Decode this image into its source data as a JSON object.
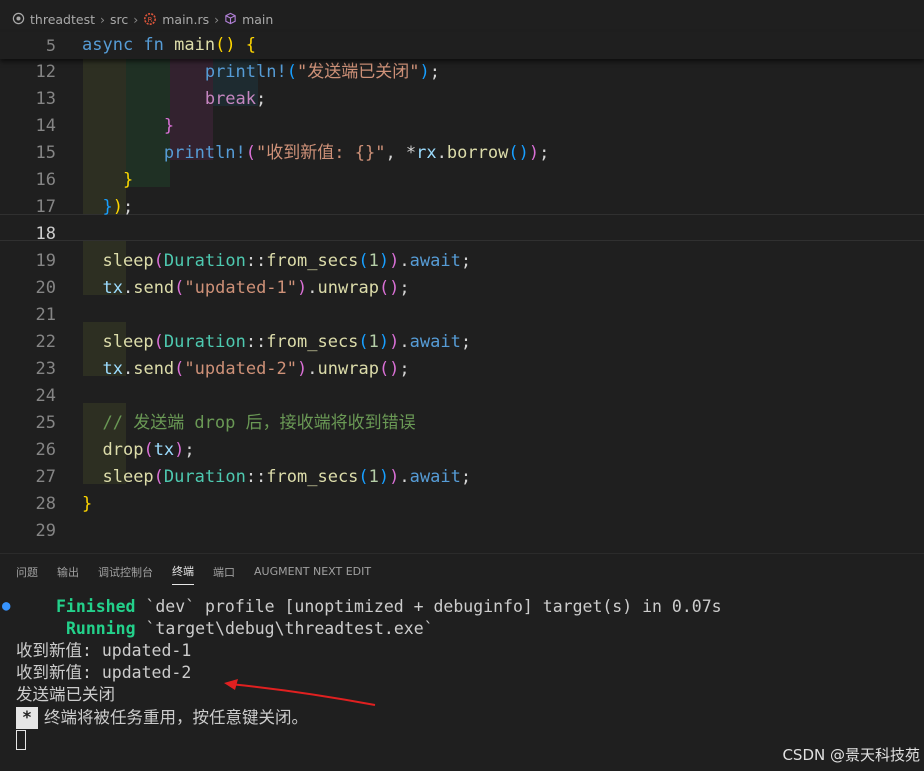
{
  "breadcrumb": {
    "project": "threadtest",
    "folder": "src",
    "file": "main.rs",
    "symbol": "main",
    "project_icon": "target-icon",
    "file_icon": "rust-icon",
    "symbol_icon": "cube-icon"
  },
  "editor": {
    "sticky": {
      "num": "5",
      "parts": [
        [
          "kw",
          "async "
        ],
        [
          "kw",
          "fn "
        ],
        [
          "fn",
          "main"
        ],
        [
          "b1",
          "() {"
        ]
      ]
    },
    "lines": [
      {
        "num": "12",
        "indent": 0,
        "parts": [
          [
            "",
            "            "
          ],
          [
            "mac",
            "println!"
          ],
          [
            "b3",
            "("
          ],
          [
            "str",
            "\"发送端已关闭\""
          ],
          [
            "b3",
            ")"
          ],
          [
            "op",
            ";"
          ]
        ]
      },
      {
        "num": "13",
        "parts": [
          [
            "",
            "            "
          ],
          [
            "ctl",
            "break"
          ],
          [
            "op",
            ";"
          ]
        ]
      },
      {
        "num": "14",
        "parts": [
          [
            "",
            "        "
          ],
          [
            "b2",
            "}"
          ]
        ]
      },
      {
        "num": "15",
        "parts": [
          [
            "",
            "        "
          ],
          [
            "mac",
            "println!"
          ],
          [
            "b2",
            "("
          ],
          [
            "str",
            "\"收到新值: {}\""
          ],
          [
            "op",
            ", *"
          ],
          [
            "var",
            "rx"
          ],
          [
            "op",
            "."
          ],
          [
            "fn",
            "borrow"
          ],
          [
            "b3",
            "()"
          ],
          [
            "b2",
            ")"
          ],
          [
            "op",
            ";"
          ]
        ]
      },
      {
        "num": "16",
        "parts": [
          [
            "",
            "    "
          ],
          [
            "b1",
            "}"
          ]
        ]
      },
      {
        "num": "17",
        "parts": [
          [
            "",
            "  "
          ],
          [
            "b3",
            "}"
          ],
          [
            "b1",
            ")"
          ],
          [
            "op",
            ";"
          ]
        ]
      },
      {
        "num": "18",
        "parts": [
          [
            "",
            ""
          ]
        ]
      },
      {
        "num": "19",
        "parts": [
          [
            "",
            "  "
          ],
          [
            "fn",
            "sleep"
          ],
          [
            "b2",
            "("
          ],
          [
            "ty",
            "Duration"
          ],
          [
            "op",
            "::"
          ],
          [
            "fn",
            "from_secs"
          ],
          [
            "b3",
            "("
          ],
          [
            "num",
            "1"
          ],
          [
            "b3",
            ")"
          ],
          [
            "b2",
            ")"
          ],
          [
            "op",
            "."
          ],
          [
            "kw",
            "await"
          ],
          [
            "op",
            ";"
          ]
        ]
      },
      {
        "num": "20",
        "parts": [
          [
            "",
            "  "
          ],
          [
            "var",
            "tx"
          ],
          [
            "op",
            "."
          ],
          [
            "fn",
            "send"
          ],
          [
            "b2",
            "("
          ],
          [
            "str",
            "\"updated-1\""
          ],
          [
            "b2",
            ")"
          ],
          [
            "op",
            "."
          ],
          [
            "fn",
            "unwrap"
          ],
          [
            "b2",
            "()"
          ],
          [
            "op",
            ";"
          ]
        ]
      },
      {
        "num": "21",
        "parts": [
          [
            "",
            ""
          ]
        ]
      },
      {
        "num": "22",
        "parts": [
          [
            "",
            "  "
          ],
          [
            "fn",
            "sleep"
          ],
          [
            "b2",
            "("
          ],
          [
            "ty",
            "Duration"
          ],
          [
            "op",
            "::"
          ],
          [
            "fn",
            "from_secs"
          ],
          [
            "b3",
            "("
          ],
          [
            "num",
            "1"
          ],
          [
            "b3",
            ")"
          ],
          [
            "b2",
            ")"
          ],
          [
            "op",
            "."
          ],
          [
            "kw",
            "await"
          ],
          [
            "op",
            ";"
          ]
        ]
      },
      {
        "num": "23",
        "parts": [
          [
            "",
            "  "
          ],
          [
            "var",
            "tx"
          ],
          [
            "op",
            "."
          ],
          [
            "fn",
            "send"
          ],
          [
            "b2",
            "("
          ],
          [
            "str",
            "\"updated-2\""
          ],
          [
            "b2",
            ")"
          ],
          [
            "op",
            "."
          ],
          [
            "fn",
            "unwrap"
          ],
          [
            "b2",
            "()"
          ],
          [
            "op",
            ";"
          ]
        ]
      },
      {
        "num": "24",
        "parts": [
          [
            "",
            ""
          ]
        ]
      },
      {
        "num": "25",
        "parts": [
          [
            "",
            "  "
          ],
          [
            "cm",
            "// 发送端 drop 后，接收端将收到错误"
          ]
        ]
      },
      {
        "num": "26",
        "parts": [
          [
            "",
            "  "
          ],
          [
            "fn",
            "drop"
          ],
          [
            "b2",
            "("
          ],
          [
            "var",
            "tx"
          ],
          [
            "b2",
            ")"
          ],
          [
            "op",
            ";"
          ]
        ]
      },
      {
        "num": "27",
        "parts": [
          [
            "",
            "  "
          ],
          [
            "fn",
            "sleep"
          ],
          [
            "b2",
            "("
          ],
          [
            "ty",
            "Duration"
          ],
          [
            "op",
            "::"
          ],
          [
            "fn",
            "from_secs"
          ],
          [
            "b3",
            "("
          ],
          [
            "num",
            "1"
          ],
          [
            "b3",
            ")"
          ],
          [
            "b2",
            ")"
          ],
          [
            "op",
            "."
          ],
          [
            "kw",
            "await"
          ],
          [
            "op",
            ";"
          ]
        ]
      },
      {
        "num": "28",
        "parts": [
          [
            "b1",
            "}"
          ]
        ]
      },
      {
        "num": "29",
        "parts": [
          [
            "",
            ""
          ]
        ]
      }
    ],
    "current_line": "18"
  },
  "panel": {
    "tabs": [
      "问题",
      "输出",
      "调试控制台",
      "终端",
      "端口",
      "AUGMENT NEXT EDIT"
    ],
    "active_tab": "终端"
  },
  "terminal": {
    "finished_label": "Finished",
    "finished_text": " `dev` profile [unoptimized + debuginfo] target(s) in 0.07s",
    "running_label": "Running",
    "running_text": " `target\\debug\\threadtest.exe`",
    "output": [
      "收到新值: updated-1",
      "收到新值: updated-2",
      "发送端已关闭"
    ],
    "reuse_marker": "*",
    "reuse_message": "终端将被任务重用，按任意键关闭。"
  },
  "colors": {
    "annotation_arrow": "#e02020",
    "success": "#23d18b"
  },
  "watermark": "CSDN @景天科技苑"
}
